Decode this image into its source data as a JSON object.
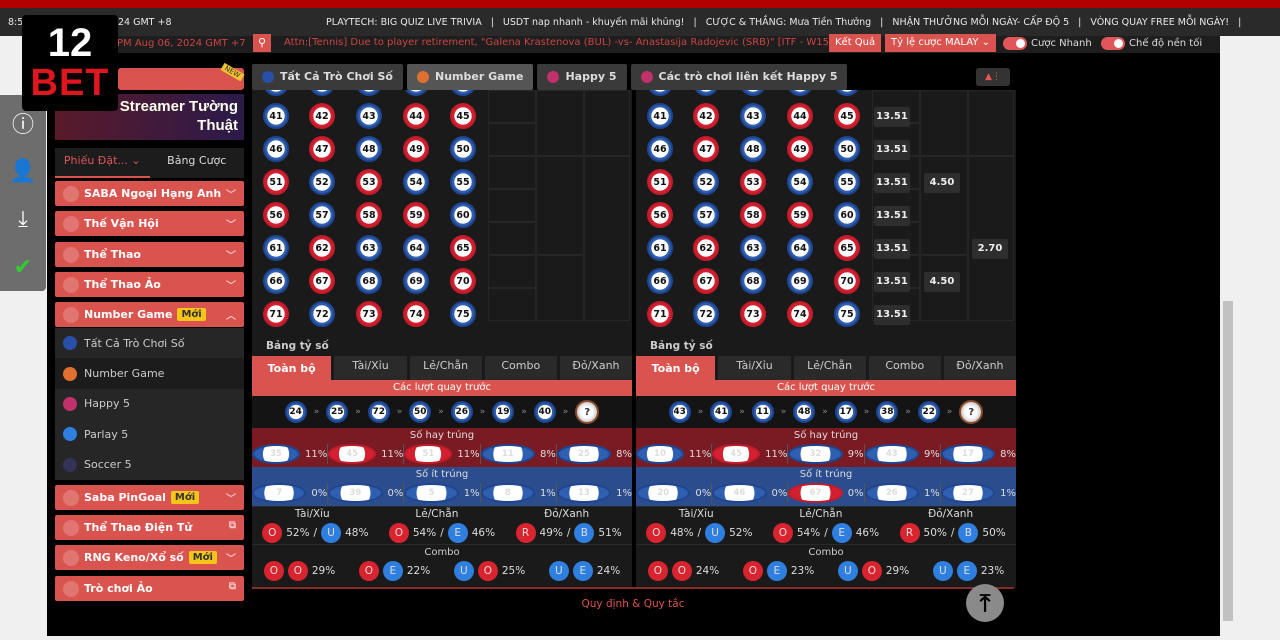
{
  "topbar": {
    "time_partial": "8:5",
    "gmt8": "24 GMT +8",
    "marquee": [
      "PLAYTECH: BIG QUIZ LIVE TRIVIA",
      "|",
      "USDT nap nhanh - khuyến mãi khủng!",
      "|",
      "CƯỢC & THẮNG: Mưa Tiền Thưởng",
      "|",
      "NHẬN THƯỞNG MỖI NGÀY- CẤP ĐỘ 5",
      "|",
      "VÒNG QUAY FREE MỖI NGÀY!",
      "|"
    ]
  },
  "bar2": {
    "time": "PM Aug 06, 2024 GMT +7",
    "ticker": "Attn:[Tennis] Due to player retirement, \"Galena Krastenova (BUL) -vs- Anastasija Radojevic (SRB)\" [ITF - W15",
    "results": "Kết Quả",
    "odds_type": "Tỷ lệ cược MALAY",
    "toggle_fast": "Cược Nhanh",
    "toggle_dark": "Chế độ nền tối"
  },
  "logo": {
    "line1": "12",
    "line2": "BET"
  },
  "float_icons": [
    "info-icon",
    "support-agent-icon",
    "download-icon",
    "dns-shield-icon"
  ],
  "sidebar": {
    "promo_new": "NEW",
    "promo_banner": "Hot Streamer Tường Thuật",
    "tabs": [
      "Phiếu Đặt...",
      "Bảng Cược"
    ],
    "items": [
      {
        "label": "SABA Ngoại Hạng Anh",
        "badge": "",
        "action": "chevron-down"
      },
      {
        "label": "Thế Vận Hội",
        "badge": "",
        "action": "chevron-down"
      },
      {
        "label": "Thể Thao",
        "badge": "",
        "action": "chevron-down"
      },
      {
        "label": "Thể Thao Ảo",
        "badge": "",
        "action": "chevron-down"
      },
      {
        "label": "Number Game",
        "badge": "Mới",
        "action": "chevron-up"
      }
    ],
    "sub": [
      {
        "label": "Tất Cả Trò Chơi Số",
        "color": "#2a4fa8"
      },
      {
        "label": "Number Game",
        "color": "#e07030"
      },
      {
        "label": "Happy 5",
        "color": "#c0306a"
      },
      {
        "label": "Parlay 5",
        "color": "#2f7fe0"
      },
      {
        "label": "Soccer 5",
        "color": "#335"
      }
    ],
    "items2": [
      {
        "label": "Saba PinGoal",
        "badge": "Mới",
        "action": "chevron-down"
      },
      {
        "label": "Thể Thao Điện Tử",
        "badge": "",
        "action": "external-link"
      },
      {
        "label": "RNG Keno/Xổ số",
        "badge": "Mới",
        "action": "chevron-down"
      },
      {
        "label": "Trò chơi Ảo",
        "badge": "",
        "action": "external-link"
      }
    ]
  },
  "content_tabs": [
    {
      "label": "Tất Cả Trò Chơi Số",
      "color": "#2a4fa8"
    },
    {
      "label": "Number Game",
      "color": "#e07030",
      "active": true
    },
    {
      "label": "Happy 5",
      "color": "#c0306a"
    },
    {
      "label": "Các trò chơi liên kết Happy 5",
      "color": "#c0306a"
    }
  ],
  "ball_colors": {
    "red": "#d32030",
    "blue": "#2f5fb0"
  },
  "red_numbers": [
    42,
    44,
    45,
    47,
    49,
    51,
    53,
    56,
    58,
    59,
    62,
    65,
    67,
    70,
    71,
    73,
    74
  ],
  "grid_numbers_from": 41,
  "grid_numbers_to": 75,
  "panels": [
    {
      "odds_single": [],
      "odds_5": [],
      "odds_3": [],
      "stats": {
        "title": "Bảng tỷ số",
        "tabs": [
          "Toàn bộ",
          "Tài/Xỉu",
          "Lẻ/Chẵn",
          "Combo",
          "Đỏ/Xanh"
        ],
        "prev_title": "Các lượt quay trước",
        "prev": [
          24,
          25,
          72,
          50,
          26,
          19,
          40
        ],
        "next": "?",
        "hot_title": "Số hay trúng",
        "hot": [
          [
            35,
            "11%"
          ],
          [
            45,
            "11%"
          ],
          [
            51,
            "11%"
          ],
          [
            11,
            "8%"
          ],
          [
            25,
            "8%"
          ]
        ],
        "cold_title": "Số ít trúng",
        "cold": [
          [
            7,
            "0%"
          ],
          [
            39,
            "0%"
          ],
          [
            5,
            "1%"
          ],
          [
            8,
            "1%"
          ],
          [
            13,
            "1%"
          ]
        ],
        "groups": [
          {
            "title": "Tài/Xỉu",
            "a": "O",
            "ap": "52%",
            "b": "U",
            "bp": "48%"
          },
          {
            "title": "Lẻ/Chẵn",
            "a": "O",
            "ap": "54%",
            "b": "E",
            "bp": "46%"
          },
          {
            "title": "Đỏ/Xanh",
            "a": "R",
            "ap": "49%",
            "b": "B",
            "bp": "51%"
          }
        ],
        "combo_title": "Combo",
        "combo": [
          [
            "O",
            "O",
            "29%"
          ],
          [
            "O",
            "E",
            "22%"
          ],
          [
            "U",
            "O",
            "25%"
          ],
          [
            "U",
            "E",
            "24%"
          ]
        ]
      }
    },
    {
      "odds_single": [
        "13.51",
        "13.51",
        "13.51",
        "13.51",
        "13.51",
        "13.51",
        "13.51"
      ],
      "odds_5": [
        [
          "51",
          "4.50"
        ],
        [
          "66",
          "4.50"
        ]
      ],
      "odds_3": [
        [
          "61",
          "2.70"
        ]
      ],
      "stats": {
        "title": "Bảng tỷ số",
        "tabs": [
          "Toàn bộ",
          "Tài/Xỉu",
          "Lẻ/Chẵn",
          "Combo",
          "Đỏ/Xanh"
        ],
        "prev_title": "Các lượt quay trước",
        "prev": [
          43,
          41,
          11,
          48,
          17,
          38,
          22
        ],
        "next": "?",
        "hot_title": "Số hay trúng",
        "hot": [
          [
            10,
            "11%"
          ],
          [
            45,
            "11%"
          ],
          [
            32,
            "9%"
          ],
          [
            43,
            "9%"
          ],
          [
            17,
            "8%"
          ]
        ],
        "cold_title": "Số ít trúng",
        "cold": [
          [
            20,
            "0%"
          ],
          [
            46,
            "0%"
          ],
          [
            67,
            "0%"
          ],
          [
            26,
            "1%"
          ],
          [
            27,
            "1%"
          ]
        ],
        "groups": [
          {
            "title": "Tài/Xỉu",
            "a": "O",
            "ap": "48%",
            "b": "U",
            "bp": "52%"
          },
          {
            "title": "Lẻ/Chẵn",
            "a": "O",
            "ap": "54%",
            "b": "E",
            "bp": "46%"
          },
          {
            "title": "Đỏ/Xanh",
            "a": "R",
            "ap": "50%",
            "b": "B",
            "bp": "50%"
          }
        ],
        "combo_title": "Combo",
        "combo": [
          [
            "O",
            "O",
            "24%"
          ],
          [
            "O",
            "E",
            "23%"
          ],
          [
            "U",
            "O",
            "29%"
          ],
          [
            "U",
            "E",
            "23%"
          ]
        ]
      }
    }
  ],
  "footer": {
    "rules": "Quy định & Quy tắc"
  }
}
